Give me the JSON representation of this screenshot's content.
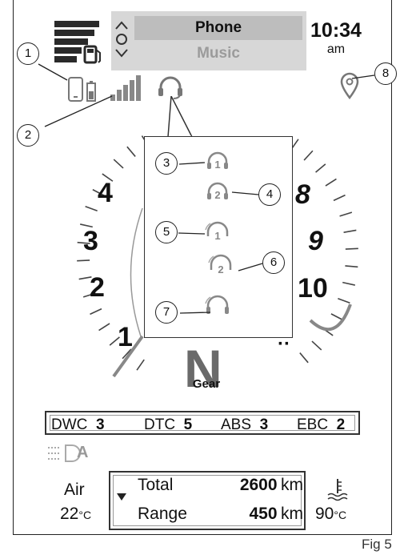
{
  "header": {
    "menu_selected": "Phone",
    "menu_next": "Music",
    "time": "10:34",
    "am_pm": "am"
  },
  "icons": {
    "fuel": "fuel-level-icon",
    "menu_scroll": "up-down-arrows-icon",
    "phone": "phone-battery-icon",
    "signal": "signal-strength-icon",
    "headset": "headset-icon",
    "nav": "location-pin-icon",
    "lights": "auto-headlight-icon",
    "temp": "coolant-temperature-icon"
  },
  "tach": {
    "labels": [
      "1",
      "2",
      "3",
      "4",
      "8",
      "9",
      "10"
    ]
  },
  "popup": {
    "items": [
      "headset-1-connected",
      "headset-2-connected",
      "headset-1-searching",
      "headset-2-searching",
      "headset-generic"
    ]
  },
  "gear": {
    "value": "N",
    "label": "Gear"
  },
  "modes": [
    {
      "name": "DWC",
      "level": "3"
    },
    {
      "name": "DTC",
      "level": "5"
    },
    {
      "name": "ABS",
      "level": "3"
    },
    {
      "name": "EBC",
      "level": "2"
    }
  ],
  "lights": {
    "auto_label": "A"
  },
  "air": {
    "label": "Air",
    "value": "22",
    "unit": "°C"
  },
  "trip": {
    "rows": [
      {
        "label": "Total",
        "value": "2600",
        "unit": "km"
      },
      {
        "label": "Range",
        "value": "450",
        "unit": "km"
      }
    ]
  },
  "coolant": {
    "value": "90",
    "unit": "°C"
  },
  "callouts": [
    "1",
    "2",
    "3",
    "4",
    "5",
    "6",
    "7",
    "8"
  ],
  "figure_label": "Fig 5"
}
